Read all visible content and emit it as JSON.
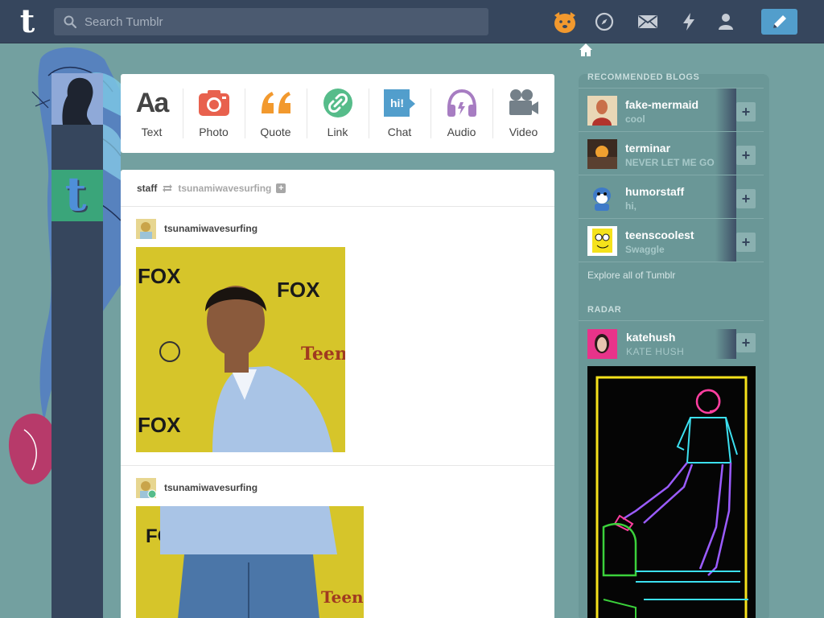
{
  "header": {
    "search_placeholder": "Search Tumblr"
  },
  "colors": {
    "header_bg": "#36465d",
    "page_bg": "#73a0a0",
    "compose_blue": "#529ecc",
    "text_icon": "#444444",
    "photo_icon": "#e8614e",
    "quote_icon": "#f2992e",
    "link_icon": "#56bc8a",
    "chat_icon": "#529ecc",
    "audio_icon": "#a77dc2",
    "video_icon": "#748089"
  },
  "post_types": [
    {
      "label": "Text",
      "icon": "text-icon"
    },
    {
      "label": "Photo",
      "icon": "camera-icon"
    },
    {
      "label": "Quote",
      "icon": "quote-icon"
    },
    {
      "label": "Link",
      "icon": "link-icon"
    },
    {
      "label": "Chat",
      "icon": "chat-icon",
      "icon_text": "hi!"
    },
    {
      "label": "Audio",
      "icon": "headphones-icon"
    },
    {
      "label": "Video",
      "icon": "video-camera-icon"
    }
  ],
  "text_icon_glyph": "Aa",
  "reblog_header": {
    "author": "staff",
    "source": "tsunamiwavesurfing",
    "plus": "+"
  },
  "posts": [
    {
      "username": "tsunamiwavesurfing"
    },
    {
      "username": "tsunamiwavesurfing"
    }
  ],
  "recommended": {
    "title": "RECOMMENDED BLOGS",
    "blogs": [
      {
        "name": "fake-mermaid",
        "subtitle": "cool"
      },
      {
        "name": "terminar",
        "subtitle": "NEVER LET ME GO"
      },
      {
        "name": "humorstaff",
        "subtitle": "hi,"
      },
      {
        "name": "teenscoolest",
        "subtitle": "Swaggle"
      }
    ],
    "follow_label": "+",
    "explore": "Explore all of Tumblr"
  },
  "radar": {
    "title": "RADAR",
    "blog": {
      "name": "katehush",
      "subtitle": "KATE HUSH"
    }
  }
}
